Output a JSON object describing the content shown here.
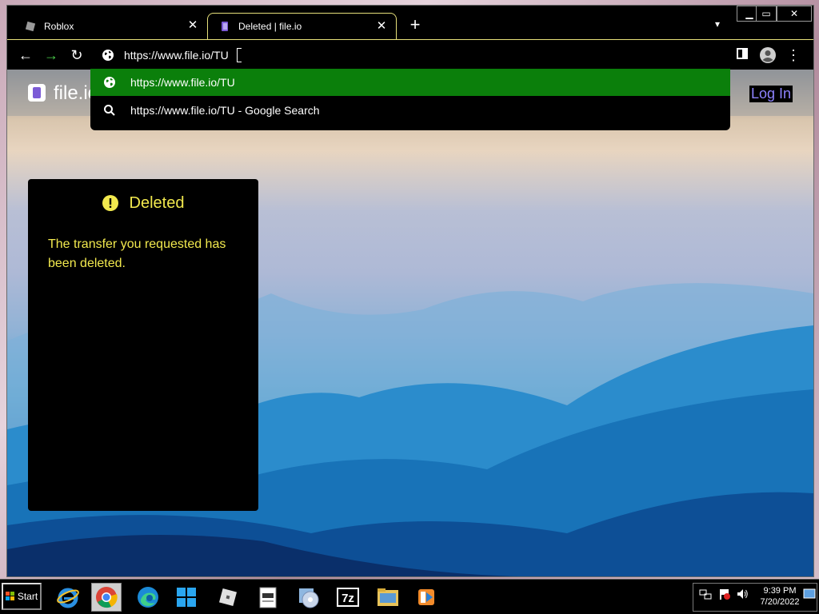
{
  "tabs": [
    {
      "label": "Roblox",
      "active": false
    },
    {
      "label": "Deleted | file.io",
      "active": true
    }
  ],
  "toolbar": {
    "url_value": "https://www.file.io/TU"
  },
  "suggestions": [
    {
      "label": "https://www.file.io/TU",
      "icon": "globe-icon",
      "selected": true
    },
    {
      "label": "https://www.file.io/TU - Google Search",
      "icon": "search-icon",
      "selected": false
    }
  ],
  "site": {
    "logo_text": "file.io",
    "login_label": "Log In"
  },
  "card": {
    "title": "Deleted",
    "message": "The transfer you requested has been deleted."
  },
  "taskbar": {
    "start_label": "Start",
    "apps": [
      "internet-explorer",
      "chrome",
      "edge",
      "roblox-studio",
      "roblox",
      "notepad",
      "disc-burner",
      "7zip",
      "file-explorer",
      "media-player"
    ],
    "clock_time": "9:39 PM",
    "clock_date": "7/20/2022"
  },
  "colors": {
    "selected_suggestion": "#0b7f0b",
    "card_text": "#f2e94e",
    "login_link": "#8e83ff",
    "active_tab_border": "#e6e07a"
  }
}
